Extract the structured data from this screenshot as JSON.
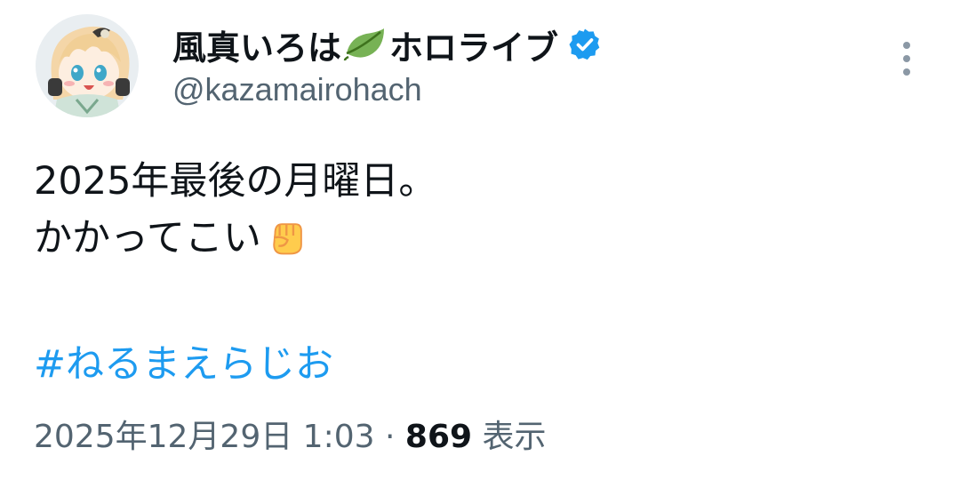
{
  "author": {
    "display_name_prefix": "風真いろは",
    "name_emoji": "leaf-icon",
    "display_name_suffix": "ホロライブ",
    "verified_badge": "verified-badge-icon",
    "handle": "@kazamairohach",
    "avatar": "avatar-image"
  },
  "more_menu": {
    "icon": "more-vertical-icon"
  },
  "tweet": {
    "line1": "2025年最後の月曜日。",
    "line2": "かかってこい",
    "line2_emoji": "raised-fist-icon",
    "hashtag": "#ねるまえらじお"
  },
  "meta": {
    "timestamp": "2025年12月29日 1:03",
    "separator": "·",
    "views_count": "869",
    "views_label": "表示"
  },
  "colors": {
    "text_primary": "#0f1419",
    "text_secondary": "#536471",
    "link": "#1d9bf0",
    "verified": "#1d9bf0"
  }
}
